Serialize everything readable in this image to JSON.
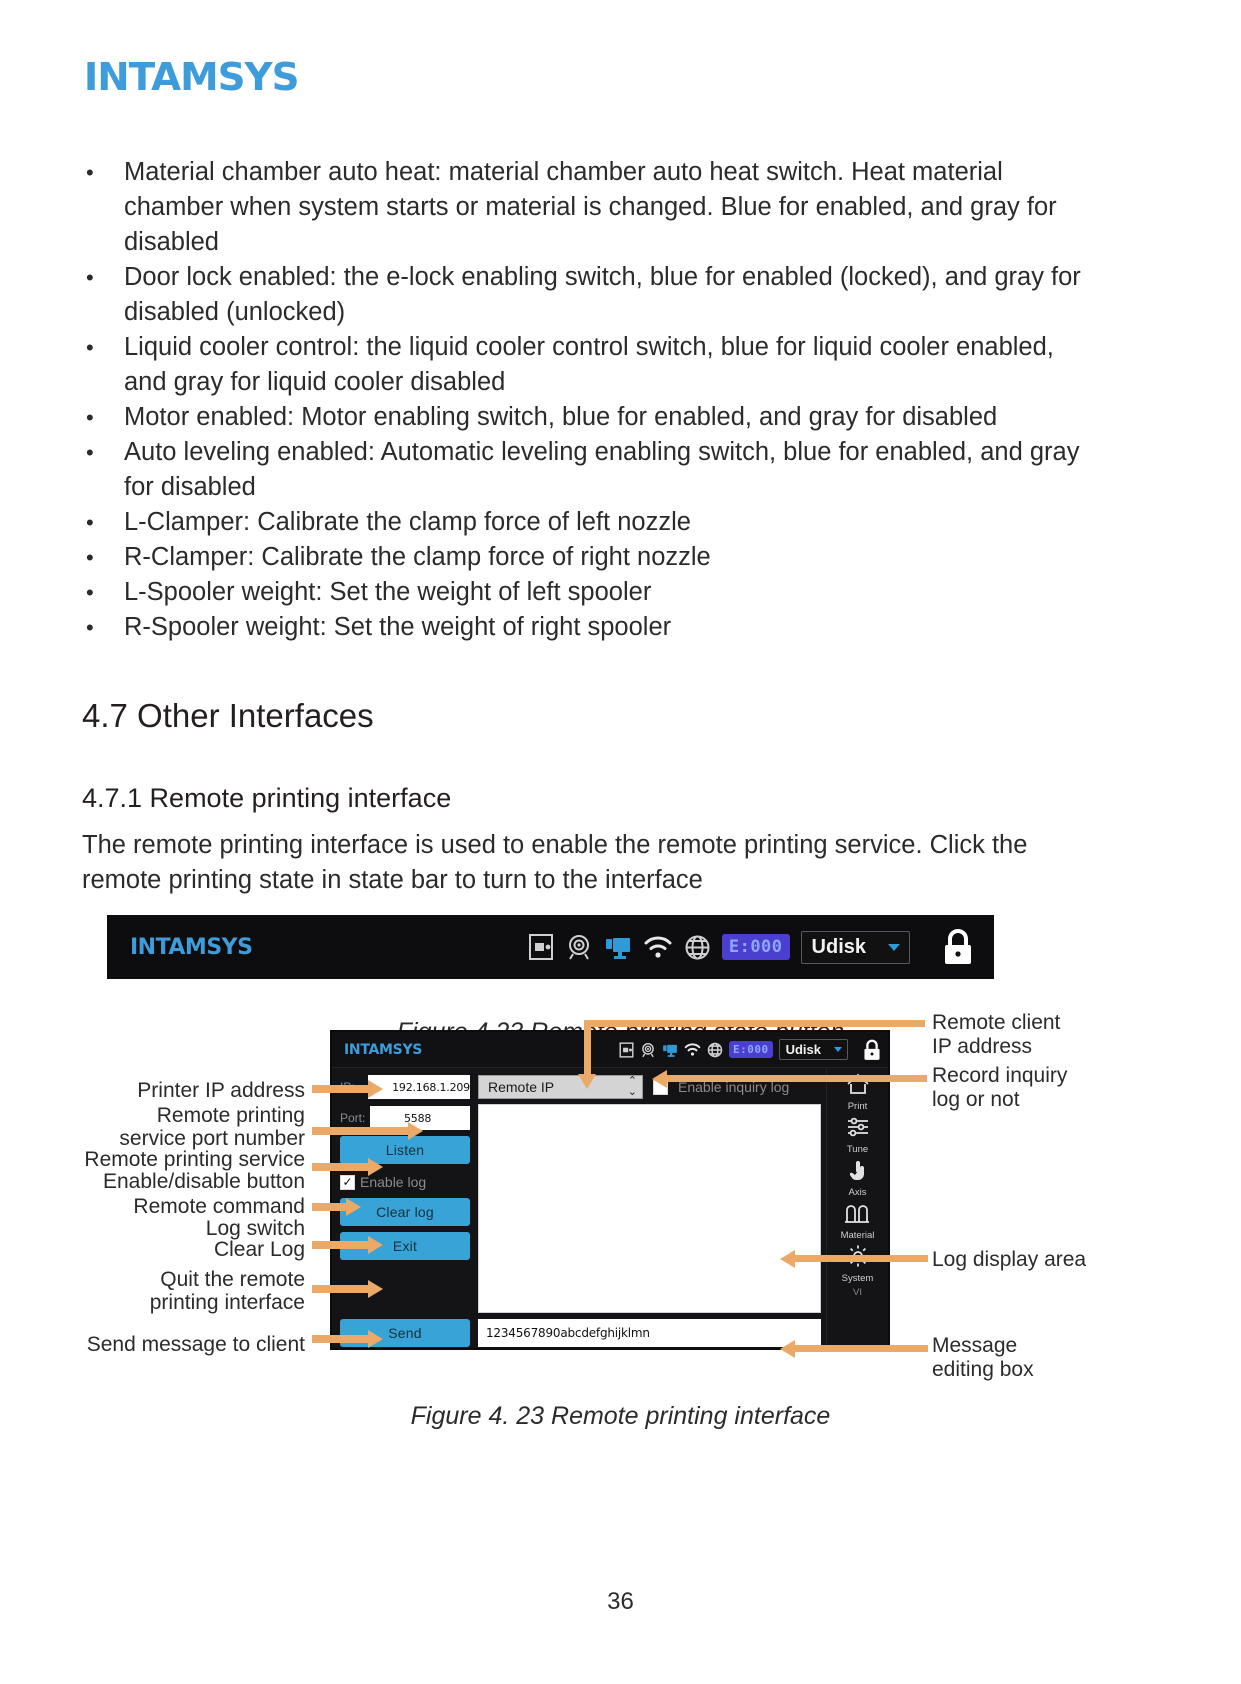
{
  "brand": {
    "logo": "INTAMSYS"
  },
  "bullets": [
    "Material chamber auto heat: material chamber auto heat switch. Heat material chamber when system starts or material is changed. Blue for enabled, and gray for disabled",
    "Door lock enabled: the e-lock enabling switch, blue for enabled (locked), and gray for disabled (unlocked)",
    "Liquid cooler control: the liquid cooler control switch, blue for liquid cooler enabled, and gray for liquid cooler disabled",
    "Motor enabled: Motor enabling switch, blue for enabled, and gray for disabled",
    "Auto leveling enabled: Automatic leveling enabling switch, blue for enabled, and gray for disabled",
    "L-Clamper: Calibrate the clamp force of left nozzle",
    "R-Clamper: Calibrate the clamp force of right nozzle",
    "L-Spooler weight: Set the weight of left spooler",
    "R-Spooler weight: Set the weight of right spooler"
  ],
  "headings": {
    "section": "4.7 Other Interfaces",
    "subsection": "4.7.1 Remote printing interface"
  },
  "paragraph": "The remote printing interface is used to enable the remote printing service. Click the remote printing state in state bar to turn to the interface",
  "figures": {
    "caption_1": "Figure 4.23 Remote printing state button",
    "caption_2": "Figure 4. 23 Remote printing interface"
  },
  "status_bar": {
    "logo": "INTAMSYS",
    "icons": [
      "door-lock-icon",
      "camera-icon",
      "remote-print-icon",
      "wifi-icon",
      "globe-icon"
    ],
    "error_badge": "E:000",
    "storage_label": "Udisk",
    "lock_icon": "padlock-icon"
  },
  "remote_ui": {
    "logo": "INTAMSYS",
    "error_badge": "E:000",
    "storage_label": "Udisk",
    "ip_label": "IP:",
    "ip_value": "192.168.1.209",
    "port_label": "Port:",
    "port_value": "5588",
    "listen_button": "Listen",
    "enable_log_label": "Enable log",
    "enable_log_checked": "✓",
    "clear_log_button": "Clear log",
    "exit_button": "Exit",
    "send_button": "Send",
    "message_value": "1234567890abcdefghijklmn",
    "remote_ip_select": "Remote IP",
    "inquiry_log_label": "Enable inquiry log",
    "nav": [
      {
        "label": "Print",
        "icon": "home-icon"
      },
      {
        "label": "Tune",
        "icon": "sliders-icon"
      },
      {
        "label": "Axis",
        "icon": "hand-touch-icon"
      },
      {
        "label": "Material",
        "icon": "spool-icon"
      },
      {
        "label": "System",
        "icon": "gear-icon"
      },
      {
        "label": "VI",
        "icon": "clipped-icon"
      }
    ]
  },
  "callouts": {
    "left": [
      "Printer IP address",
      "Remote printing\nservice port number",
      "Remote printing service\nEnable/disable button",
      "Remote command\nLog switch",
      "Clear Log",
      "Quit the remote\nprinting interface",
      "Send message to client"
    ],
    "left_flat": {
      "c1": "Printer IP address",
      "c2a": "Remote printing",
      "c2b": "service port number",
      "c3a": "Remote printing service",
      "c3b": "Enable/disable button",
      "c4a": "Remote command",
      "c4b": "Log switch",
      "c5": "Clear Log",
      "c6a": "Quit the remote",
      "c6b": "printing interface",
      "c7": "Send message to client"
    },
    "right_flat": {
      "r1a": "Remote client",
      "r1b": "IP address",
      "r2a": "Record inquiry",
      "r2b": "log or not",
      "r3": "Log display area",
      "r4a": "Message",
      "r4b": "editing box"
    }
  },
  "page_number": "36",
  "colors": {
    "brand_blue": "#3d9cd9",
    "button_blue": "#38a3d6",
    "arrow_orange": "#eba968",
    "error_purple": "#4b3fd0",
    "dark_bg": "#141417"
  }
}
